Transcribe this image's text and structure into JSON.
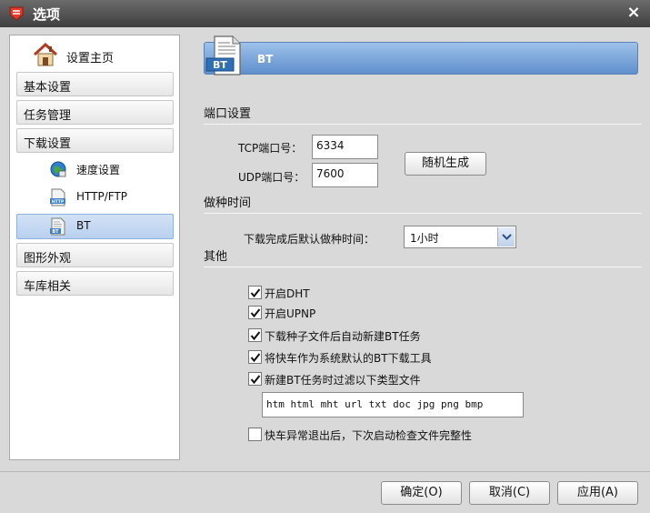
{
  "window": {
    "title": "选项"
  },
  "sidebar": {
    "home_label": "设置主页",
    "categories": [
      "基本设置",
      "任务管理",
      "下载设置",
      "图形外观",
      "车库相关"
    ],
    "subitems": [
      {
        "label": "速度设置",
        "icon": "globe-icon"
      },
      {
        "label": "HTTP/FTP",
        "icon": "http-file-icon"
      },
      {
        "label": "BT",
        "icon": "bt-file-icon",
        "selected": true
      }
    ]
  },
  "banner": {
    "title": "BT",
    "icon_text": "BT"
  },
  "port_section": {
    "heading": "端口设置",
    "tcp_label": "TCP端口号：",
    "tcp_value": "6334",
    "udp_label": "UDP端口号：",
    "udp_value": "7600",
    "random_button": "随机生成"
  },
  "seed_section": {
    "heading": "做种时间",
    "label": "下载完成后默认做种时间：",
    "value": "1小时"
  },
  "other_section": {
    "heading": "其他",
    "options": [
      {
        "label": "开启DHT",
        "checked": true
      },
      {
        "label": "开启UPNP",
        "checked": true
      },
      {
        "label": "下载种子文件后自动新建BT任务",
        "checked": true
      },
      {
        "label": "将快车作为系统默认的BT下载工具",
        "checked": true
      },
      {
        "label": "新建BT任务时过滤以下类型文件",
        "checked": true
      }
    ],
    "filter_types": "htm html mht url txt doc jpg png bmp",
    "integrity_check": {
      "label": "快车异常退出后，下次启动检查文件完整性",
      "checked": false
    }
  },
  "footer": {
    "ok": "确定(O)",
    "cancel": "取消(C)",
    "apply": "应用(A)"
  },
  "colors": {
    "accent": "#5f8fcc",
    "selection": "#b9d0ee",
    "titlebar": "#4a4a4a"
  }
}
